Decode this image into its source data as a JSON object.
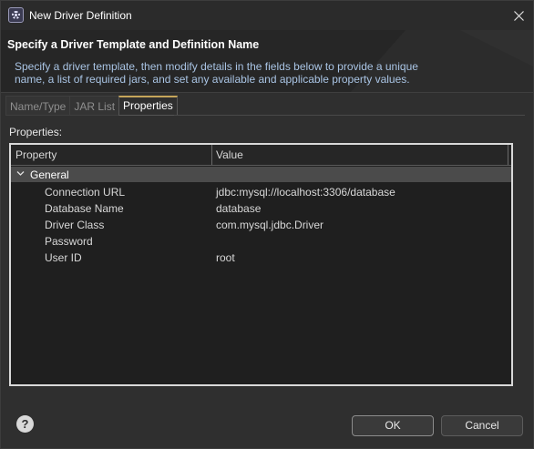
{
  "window": {
    "title": "New Driver Definition",
    "icon": "eclipse-gear-icon"
  },
  "banner": {
    "title": "Specify a Driver Template and Definition Name",
    "description": "Specify a driver template, then modify details in the fields below to provide a unique name, a list of required jars, and set any available and applicable property values."
  },
  "tabs": [
    {
      "label": "Name/Type",
      "selected": false
    },
    {
      "label": "JAR List",
      "selected": false
    },
    {
      "label": "Properties",
      "selected": true
    }
  ],
  "properties_label": "Properties:",
  "table": {
    "columns": [
      "Property",
      "Value"
    ],
    "group": "General",
    "rows": [
      {
        "property": "Connection URL",
        "value": "jdbc:mysql://localhost:3306/database"
      },
      {
        "property": "Database Name",
        "value": "database"
      },
      {
        "property": "Driver Class",
        "value": "com.mysql.jdbc.Driver"
      },
      {
        "property": "Password",
        "value": ""
      },
      {
        "property": "User ID",
        "value": "root"
      }
    ]
  },
  "buttons": {
    "help": "?",
    "ok": "OK",
    "cancel": "Cancel"
  },
  "colors": {
    "background": "#2f2f2f",
    "banner_desc": "#a9c4e4",
    "selected_tab_accent": "#c5a55a",
    "group_row": "#4b4b4b"
  }
}
